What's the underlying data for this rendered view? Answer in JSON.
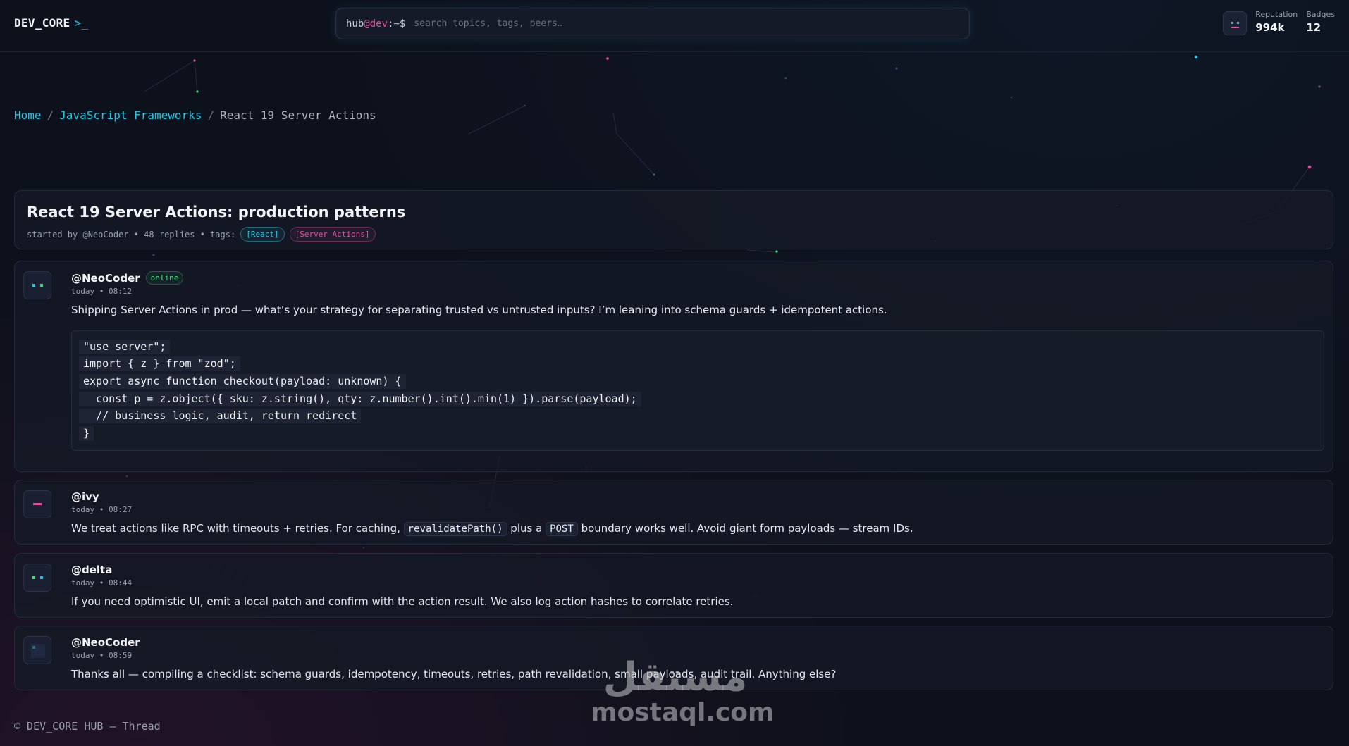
{
  "header": {
    "logo": "DEV_CORE",
    "logo_prompt": ">_",
    "search": {
      "prompt_user": "hub",
      "prompt_at": "@dev",
      "prompt_path": ":~$",
      "placeholder": "search topics, tags, peers…"
    },
    "stats": [
      {
        "label": "Reputation",
        "value": "994k"
      },
      {
        "label": "Badges",
        "value": "12"
      }
    ]
  },
  "breadcrumb": {
    "home": "Home",
    "category": "JavaScript Frameworks",
    "current": "React 19 Server Actions",
    "separator": "/"
  },
  "thread": {
    "title": "React 19 Server Actions: production patterns",
    "meta": "started by @NeoCoder • 48 replies • tags:",
    "tags": [
      "[React]",
      "[Server Actions]"
    ]
  },
  "posts": [
    {
      "author": "@NeoCoder",
      "status": "online",
      "time": "today • 08:12",
      "text": "Shipping Server Actions in prod — what’s your strategy for separating trusted vs untrusted inputs? I’m leaning into schema guards + idempotent actions.",
      "code": [
        "\"use server\";",
        "import { z } from \"zod\";",
        "export async function checkout(payload: unknown) {",
        "  const p = z.object({ sku: z.string(), qty: z.number().int().min(1) }).parse(payload);",
        "  // business logic, audit, return redirect",
        "}"
      ]
    },
    {
      "author": "@ivy",
      "time": "today • 08:27",
      "text_before": "We treat actions like RPC with timeouts + retries. For caching,",
      "code_1": "revalidatePath()",
      "text_mid": "plus a",
      "code_2": "POST",
      "text_after": "boundary works well. Avoid giant form payloads — stream IDs."
    },
    {
      "author": "@delta",
      "time": "today • 08:44",
      "text": "If you need optimistic UI, emit a local patch and confirm with the action result. We also log action hashes to correlate retries."
    },
    {
      "author": "@NeoCoder",
      "time": "today • 08:59",
      "text": "Thanks all — compiling a checklist: schema guards, idempotency, timeouts, retries, path revalidation, small payloads, audit trail. Anything else?"
    }
  ],
  "footer": "© DEV_CORE HUB — Thread",
  "watermark": {
    "arabic": "مستقل",
    "latin": "mostaql.com"
  },
  "colors": {
    "accent_cyan": "#22c7e6",
    "accent_pink": "#e34fa0",
    "online_green": "#3ee07a",
    "background": "#0d111b"
  },
  "icons": [
    "avatar-icon"
  ]
}
